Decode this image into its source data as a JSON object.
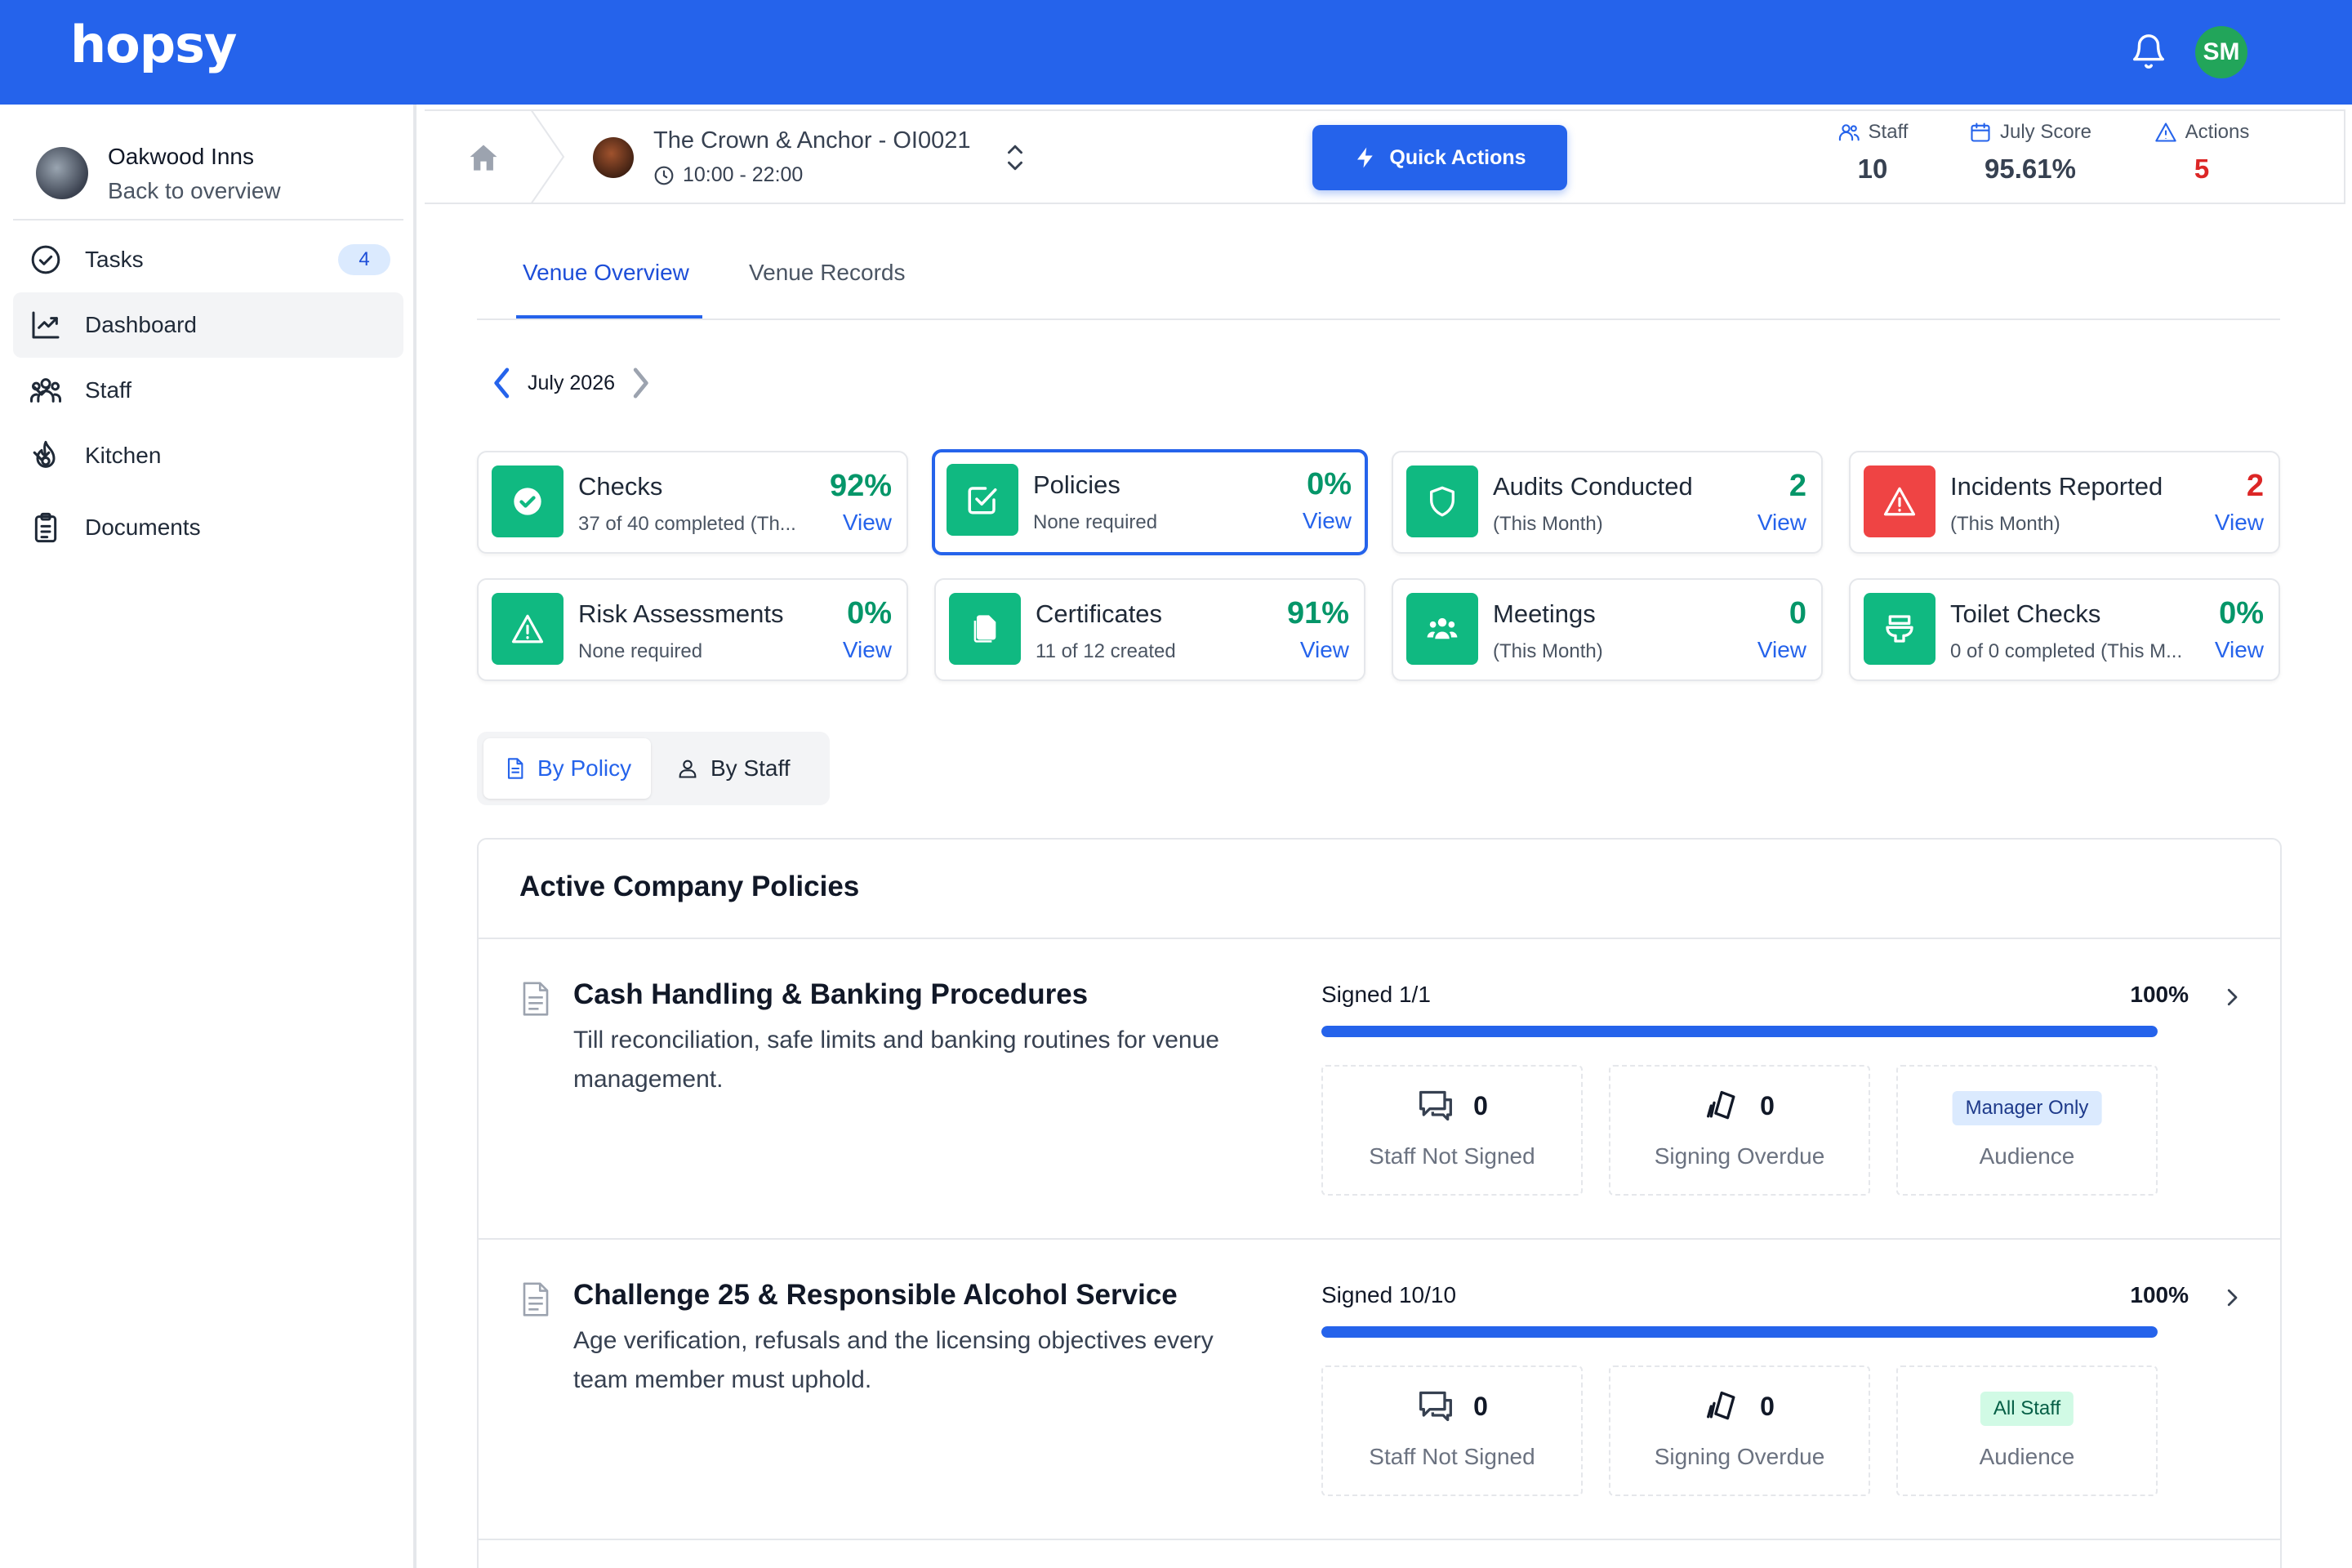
{
  "app": {
    "logo": "hopsy",
    "user_initials": "SM"
  },
  "colors": {
    "brand": "#2563eb",
    "success": "#10b981",
    "danger": "#ef4444"
  },
  "sidebar": {
    "org_name": "Oakwood Inns",
    "back_label": "Back to overview",
    "items": [
      {
        "label": "Tasks",
        "icon": "check-circle-icon",
        "badge": "4"
      },
      {
        "label": "Dashboard",
        "icon": "chart-line-icon",
        "active": true
      },
      {
        "label": "Staff",
        "icon": "users-icon",
        "expandable": true
      },
      {
        "label": "Kitchen",
        "icon": "flame-icon",
        "expandable": true
      },
      {
        "label": "Documents",
        "icon": "clipboard-icon"
      }
    ]
  },
  "header": {
    "venue_name": "The Crown & Anchor - OI0021",
    "venue_hours": "10:00 - 22:00",
    "quick_actions": "Quick Actions",
    "stats": [
      {
        "label": "Staff",
        "value": "10",
        "icon": "users-icon"
      },
      {
        "label": "July Score",
        "value": "95.61%",
        "icon": "calendar-icon"
      },
      {
        "label": "Actions",
        "value": "5",
        "icon": "warning-icon",
        "color": "#dc2626"
      }
    ]
  },
  "tabs": [
    {
      "label": "Venue Overview",
      "active": true
    },
    {
      "label": "Venue Records"
    }
  ],
  "month": {
    "label": "July 2026"
  },
  "cards": [
    {
      "title": "Checks",
      "sub": "37 of 40 completed (Th...",
      "value": "92%",
      "link": "View",
      "icon": "check-icon"
    },
    {
      "title": "Policies",
      "sub": "None required",
      "value": "0%",
      "link": "View",
      "icon": "checkbox-icon",
      "selected": true
    },
    {
      "title": "Audits Conducted",
      "sub": "(This Month)",
      "value": "2",
      "link": "View",
      "icon": "shield-icon"
    },
    {
      "title": "Incidents Reported",
      "sub": "(This Month)",
      "value": "2",
      "link": "View",
      "icon": "warning-icon",
      "danger": true
    },
    {
      "title": "Risk Assessments",
      "sub": "None required",
      "value": "0%",
      "link": "View",
      "icon": "warning-icon"
    },
    {
      "title": "Certificates",
      "sub": "11 of 12 created",
      "value": "91%",
      "link": "View",
      "icon": "files-icon"
    },
    {
      "title": "Meetings",
      "sub": "(This Month)",
      "value": "0",
      "link": "View",
      "icon": "people-icon"
    },
    {
      "title": "Toilet Checks",
      "sub": "0 of 0 completed (This M...",
      "value": "0%",
      "link": "View",
      "icon": "toilet-icon"
    }
  ],
  "view_toggle": {
    "by_policy": "By Policy",
    "by_staff": "By Staff"
  },
  "policies": {
    "title": "Active Company Policies",
    "items": [
      {
        "title": "Cash Handling & Banking Procedures",
        "desc": "Till reconciliation, safe limits and banking routines for venue management.",
        "signed": "Signed 1/1",
        "pct": "100%",
        "progress": 1.0,
        "not_signed": "0",
        "not_signed_label": "Staff Not Signed",
        "overdue": "0",
        "overdue_label": "Signing Overdue",
        "audience": "Manager Only",
        "audience_label": "Audience"
      },
      {
        "title": "Challenge 25 & Responsible Alcohol Service",
        "desc": "Age verification, refusals and the licensing objectives every team member must uphold.",
        "signed": "Signed 10/10",
        "pct": "100%",
        "progress": 1.0,
        "not_signed": "0",
        "not_signed_label": "Staff Not Signed",
        "overdue": "0",
        "overdue_label": "Signing Overdue",
        "audience": "All Staff",
        "audience_label": "Audience"
      }
    ]
  }
}
